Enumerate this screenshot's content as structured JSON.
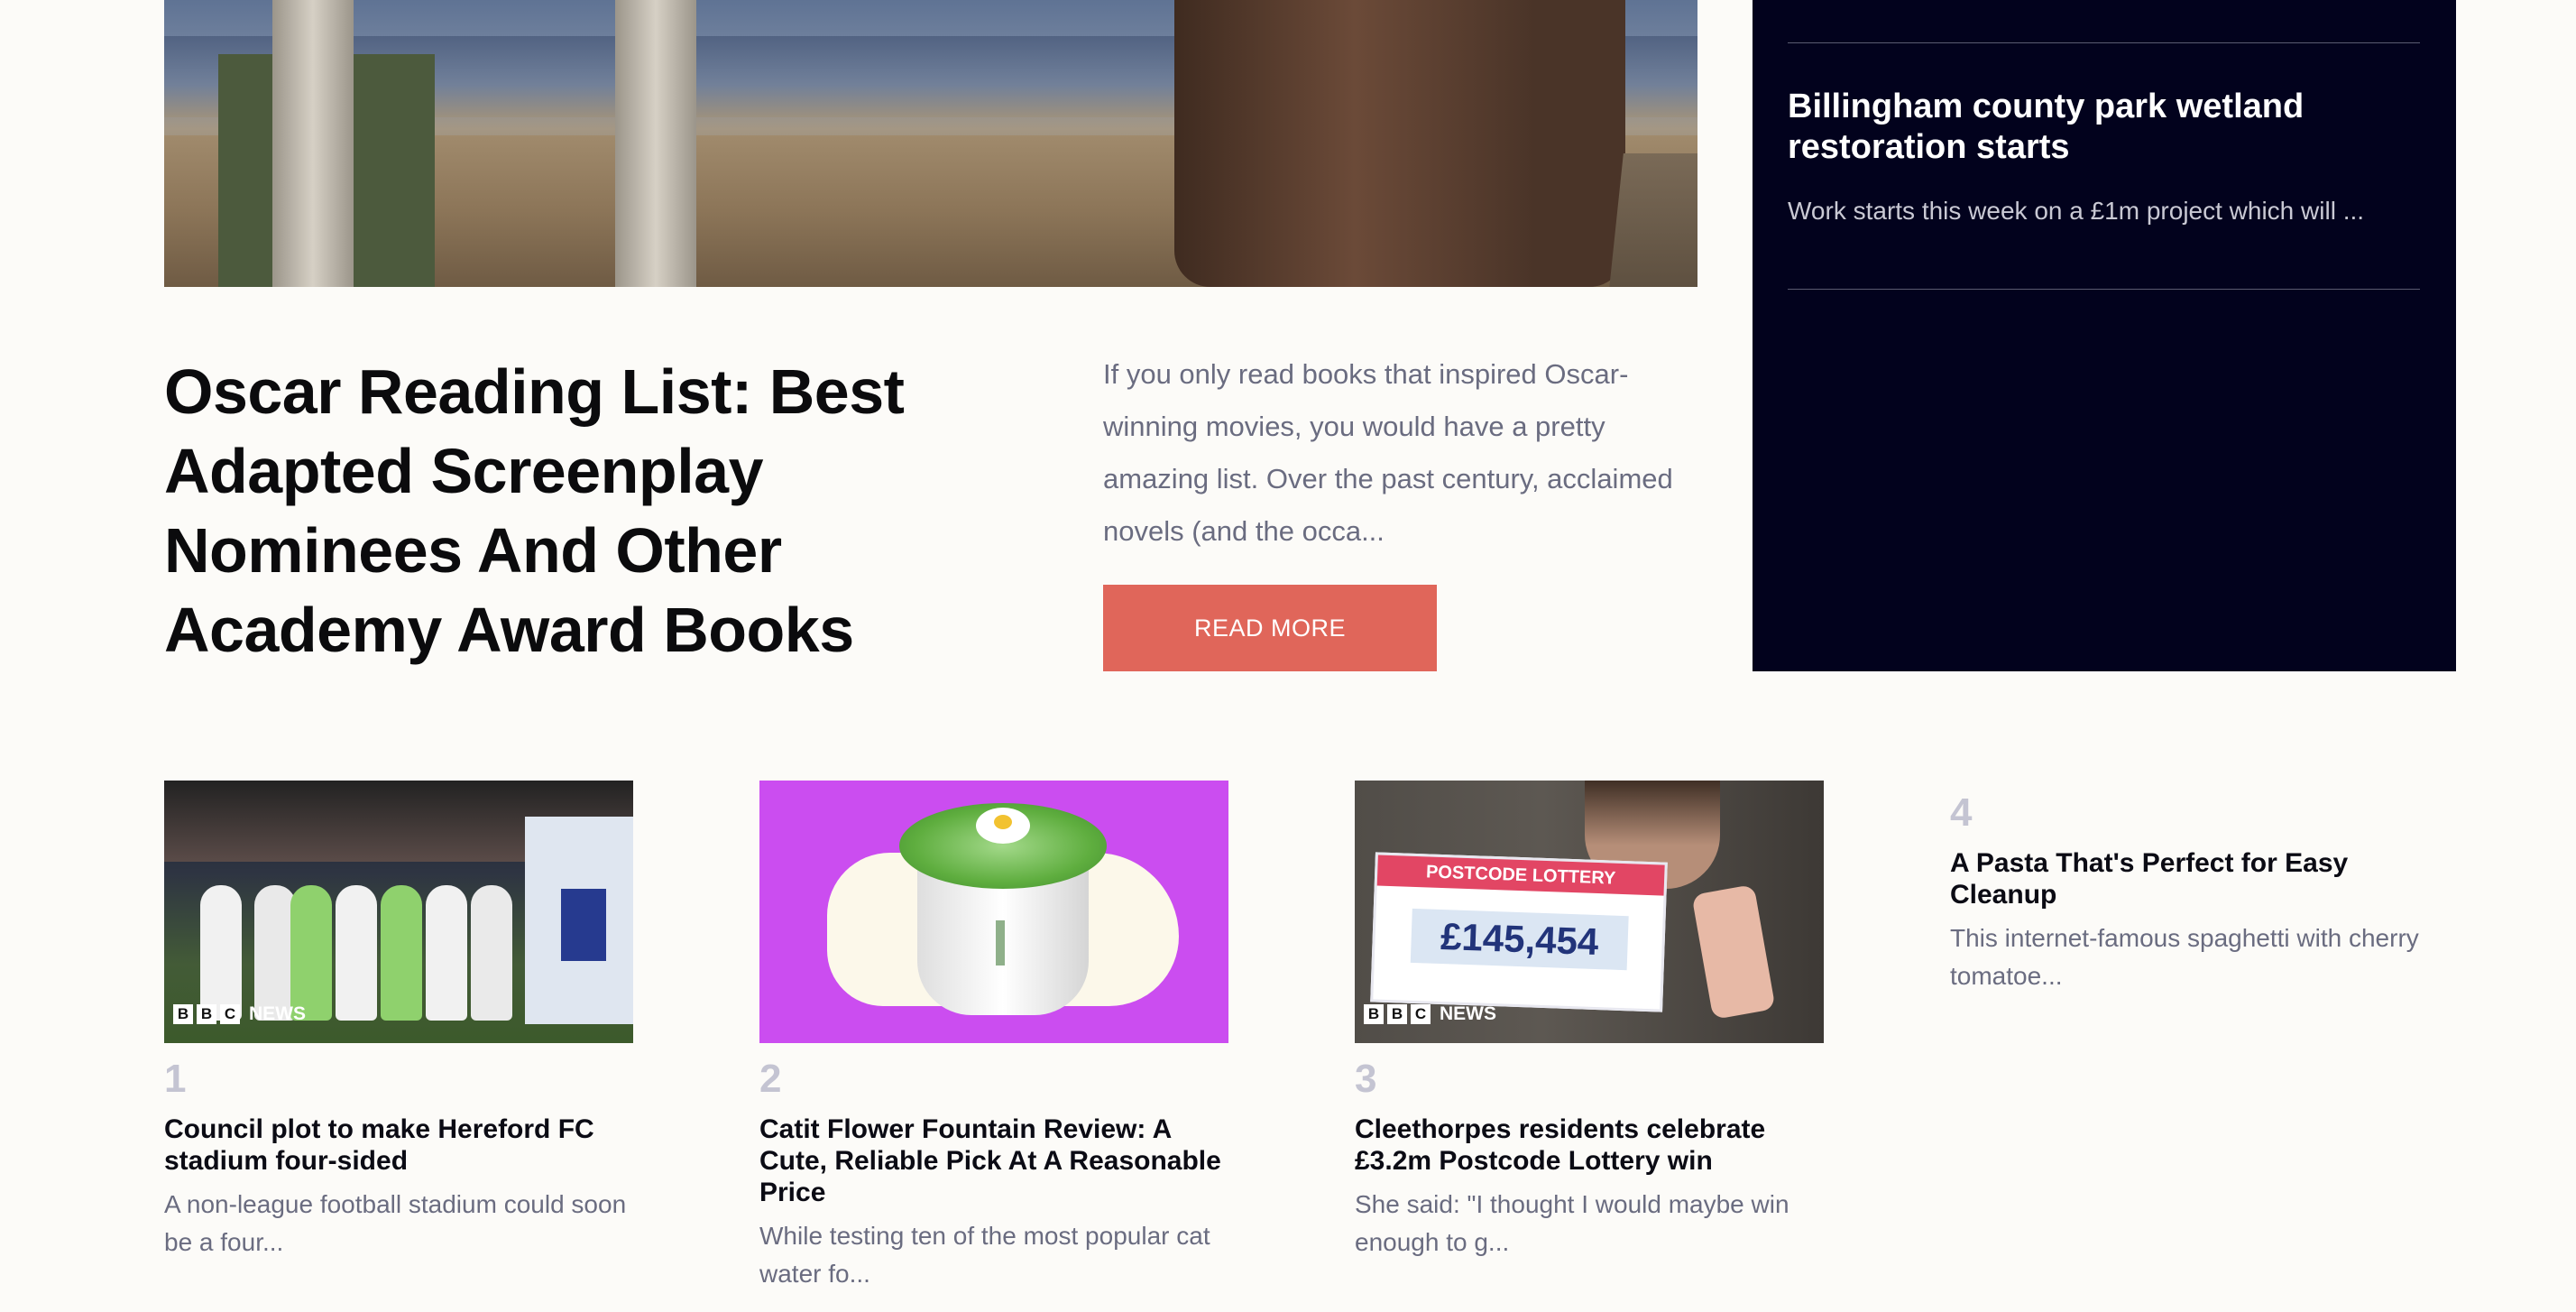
{
  "featured": {
    "title": "Oscar Reading List: Best Adapted Screenplay Nominees And Other Academy Award Books",
    "excerpt": "If you only read books that inspired Oscar-winning movies, you would have a pretty amazing list. Over the past century, acclaimed novels (and the occa...",
    "read_more": "READ MORE"
  },
  "sidebar": {
    "story": {
      "title": "Billingham county park wetland restoration starts",
      "excerpt": "Work starts this week on a £1m project which will ..."
    }
  },
  "trending": [
    {
      "number": "1",
      "title": "Council plot to make Hereford FC stadium four-sided",
      "excerpt": "A non-league football stadium could soon be a four...",
      "source_badge": "NEWS"
    },
    {
      "number": "2",
      "title": "Catit Flower Fountain Review: A Cute, Reliable Pick At A Reasonable Price",
      "excerpt": "While testing ten of the most popular cat water fo..."
    },
    {
      "number": "3",
      "title": "Cleethorpes residents celebrate £3.2m Postcode Lottery win",
      "excerpt": "She said: \"I thought I would maybe win enough to g...",
      "source_badge": "NEWS",
      "image_text": {
        "cheque_header": "POSTCODE LOTTERY",
        "cheque_amount": "£145,454"
      }
    },
    {
      "number": "4",
      "title": "A Pasta That's Perfect for Easy Cleanup",
      "excerpt": "This internet-famous spaghetti with cherry tomatoe..."
    }
  ],
  "colors": {
    "background": "#fcfbf8",
    "sidebar_bg": "#02021d",
    "read_more_bg": "#e0665a",
    "number_color": "#c4c4d2"
  }
}
